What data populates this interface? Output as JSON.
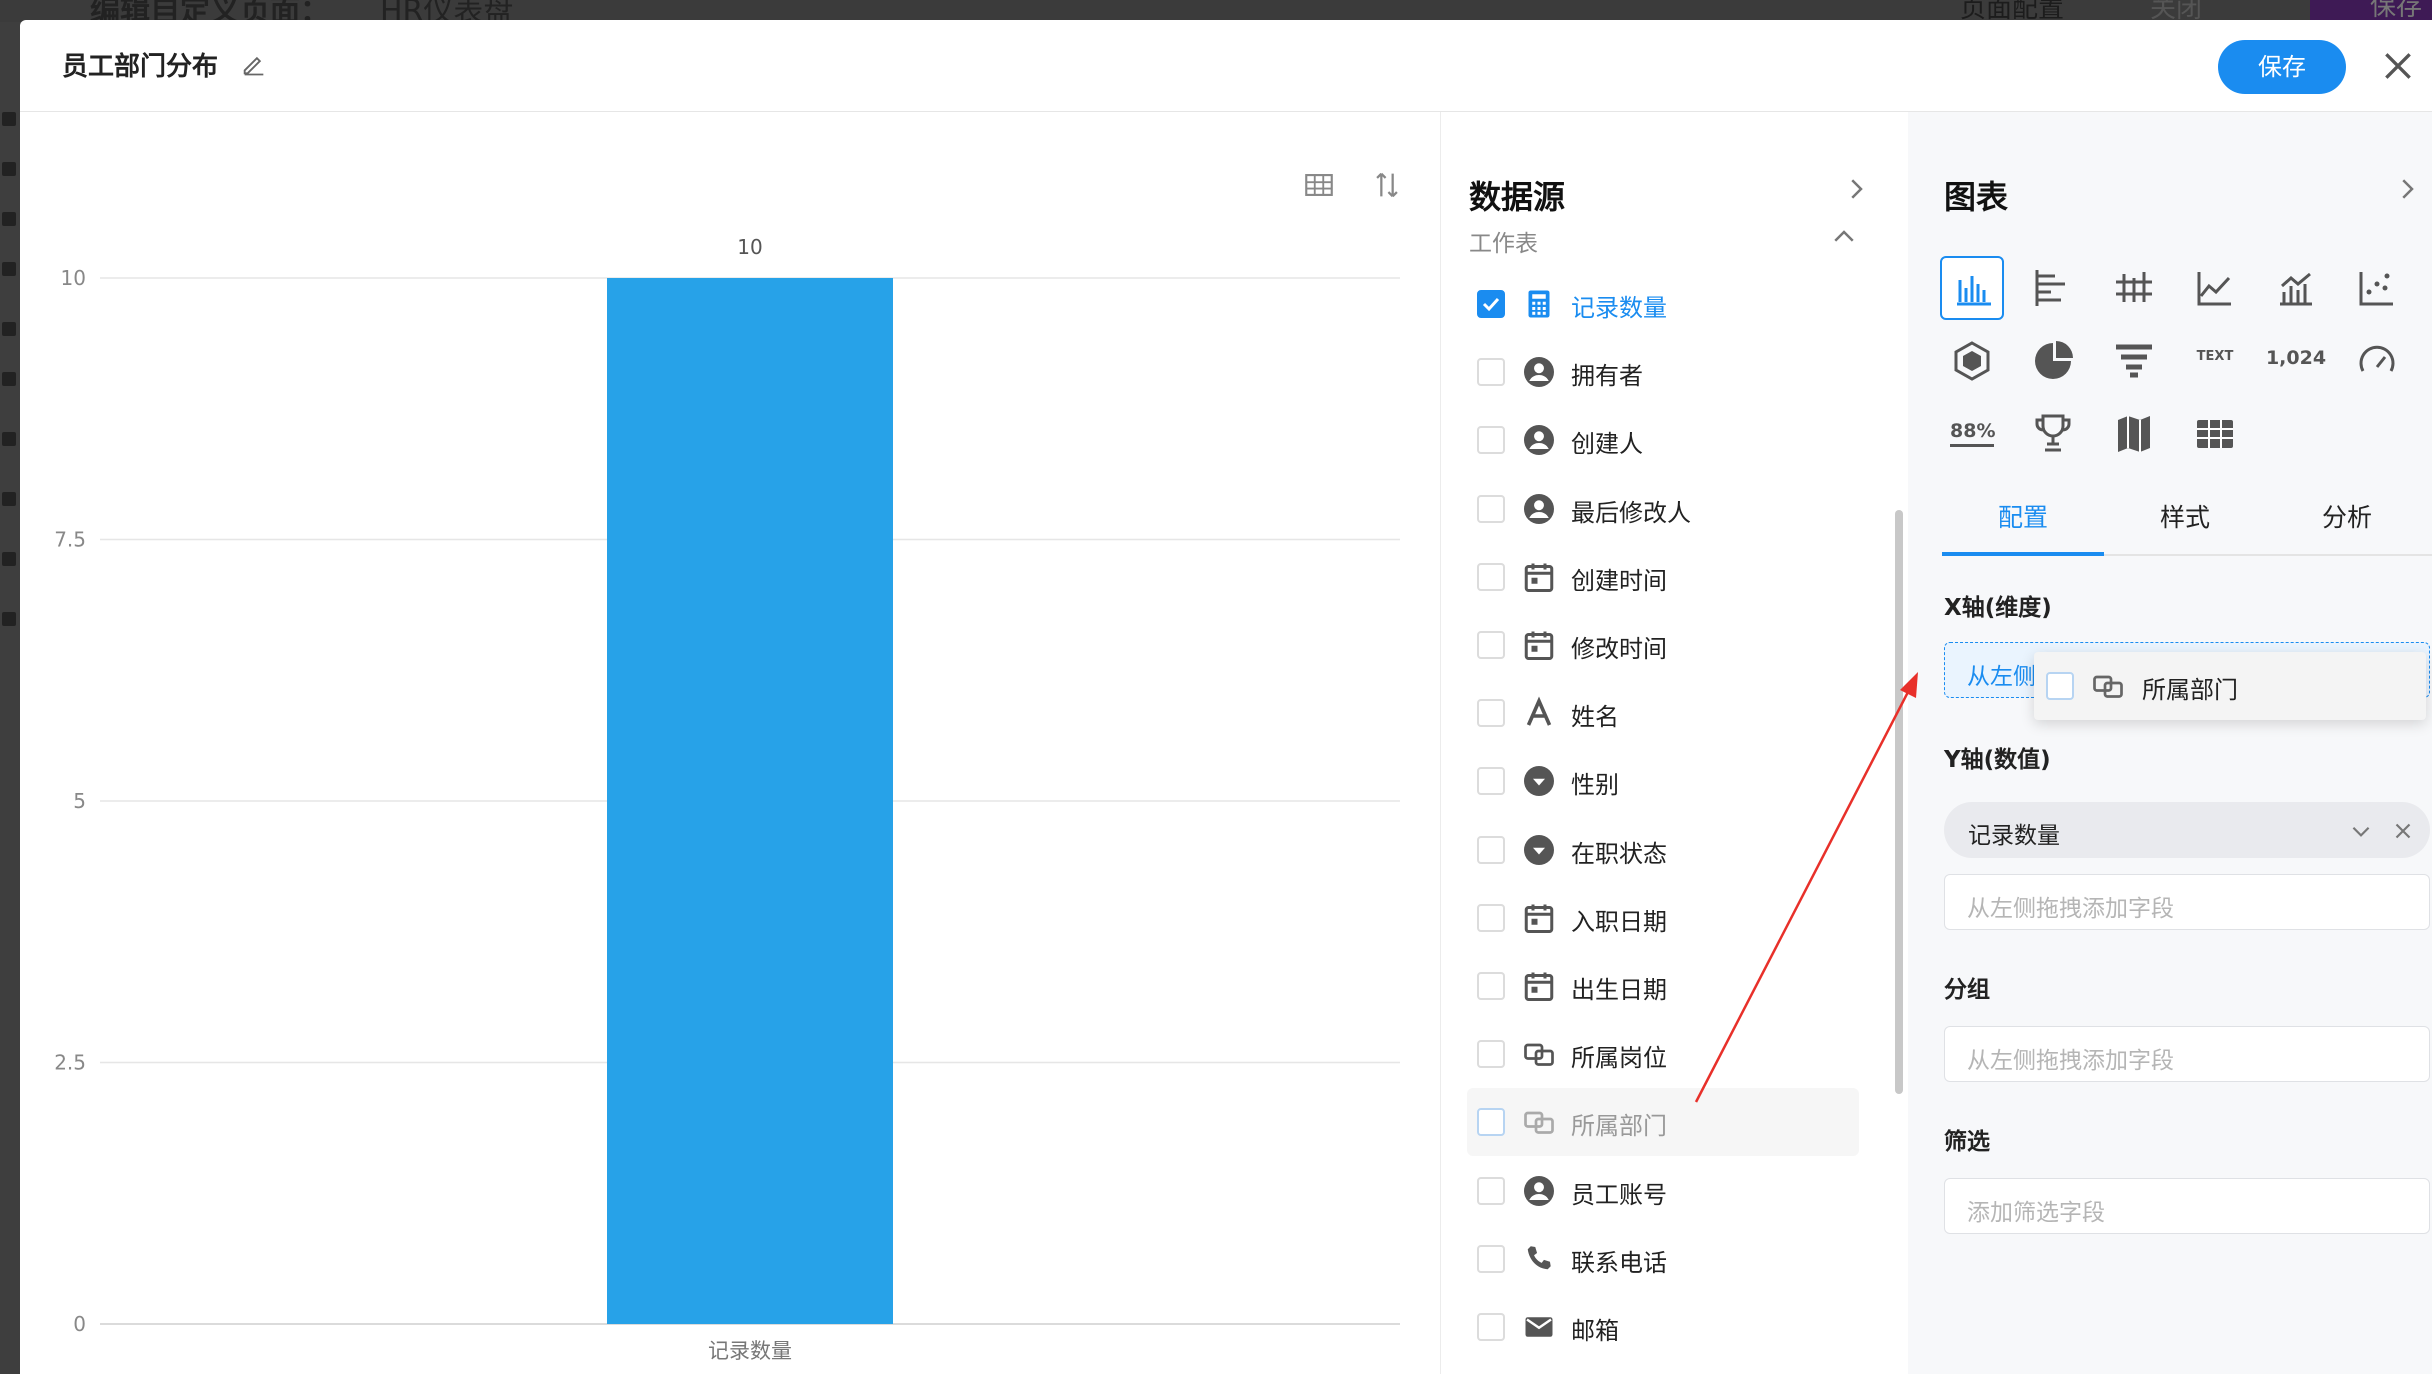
{
  "background": {
    "page_title": "编辑自定义页面：",
    "page_name": "HR仪表盘",
    "config_label": "页面配置",
    "close_label": "关闭",
    "save_label": "保存"
  },
  "modal": {
    "title": "员工部门分布",
    "save_label": "保存"
  },
  "chart_data": {
    "type": "bar",
    "categories": [
      "记录数量"
    ],
    "values": [
      10
    ],
    "data_labels": [
      "10"
    ],
    "yticks": [
      "0",
      "2.5",
      "5",
      "7.5",
      "10"
    ],
    "ylim": [
      0,
      10
    ],
    "grid": true,
    "bar_color": "#27a2e8"
  },
  "datasource": {
    "title": "数据源",
    "subtitle": "工作表",
    "fields": [
      {
        "label": "记录数量",
        "icon": "calculator-icon",
        "checked": true
      },
      {
        "label": "拥有者",
        "icon": "user-icon",
        "checked": false
      },
      {
        "label": "创建人",
        "icon": "user-icon",
        "checked": false
      },
      {
        "label": "最后修改人",
        "icon": "user-icon",
        "checked": false
      },
      {
        "label": "创建时间",
        "icon": "calendar-icon",
        "checked": false
      },
      {
        "label": "修改时间",
        "icon": "calendar-icon",
        "checked": false
      },
      {
        "label": "姓名",
        "icon": "text-icon",
        "checked": false
      },
      {
        "label": "性别",
        "icon": "dropdown-icon",
        "checked": false
      },
      {
        "label": "在职状态",
        "icon": "dropdown-icon",
        "checked": false
      },
      {
        "label": "入职日期",
        "icon": "calendar-icon",
        "checked": false
      },
      {
        "label": "出生日期",
        "icon": "calendar-icon",
        "checked": false
      },
      {
        "label": "所属岗位",
        "icon": "relation-icon",
        "checked": false
      },
      {
        "label": "所属部门",
        "icon": "relation-icon",
        "checked": false
      },
      {
        "label": "员工账号",
        "icon": "user-icon",
        "checked": false
      },
      {
        "label": "联系电话",
        "icon": "phone-icon",
        "checked": false
      },
      {
        "label": "邮箱",
        "icon": "mail-icon",
        "checked": false
      }
    ]
  },
  "config": {
    "title": "图表",
    "chart_types": [
      {
        "name": "bar-chart-icon",
        "active": true
      },
      {
        "name": "horizontal-bar-icon"
      },
      {
        "name": "stacked-bar-icon"
      },
      {
        "name": "line-chart-icon"
      },
      {
        "name": "combo-chart-icon"
      },
      {
        "name": "scatter-chart-icon"
      },
      {
        "name": "radar-chart-icon"
      },
      {
        "name": "pie-chart-icon"
      },
      {
        "name": "funnel-chart-icon"
      },
      {
        "name": "word-cloud-icon",
        "text": "TEXT"
      },
      {
        "name": "number-card-icon",
        "text": "1,024"
      },
      {
        "name": "gauge-icon"
      },
      {
        "name": "progress-icon",
        "text": "88%"
      },
      {
        "name": "ranking-icon"
      },
      {
        "name": "map-icon"
      },
      {
        "name": "table-icon"
      }
    ],
    "tabs": [
      "配置",
      "样式",
      "分析"
    ],
    "x_axis_label": "X轴(维度)",
    "x_axis_placeholder": "从左侧拖拽添加字段",
    "y_axis_label": "Y轴(数值)",
    "y_field": "记录数量",
    "y_placeholder": "从左侧拖拽添加字段",
    "group_label": "分组",
    "group_placeholder": "从左侧拖拽添加字段",
    "filter_label": "筛选",
    "filter_placeholder": "添加筛选字段"
  },
  "drag_ghost": {
    "label": "所属部门",
    "icon": "relation-icon"
  },
  "colors": {
    "accent": "#1a8cf0",
    "bar": "#27a2e8",
    "arrow": "#e8302a"
  }
}
